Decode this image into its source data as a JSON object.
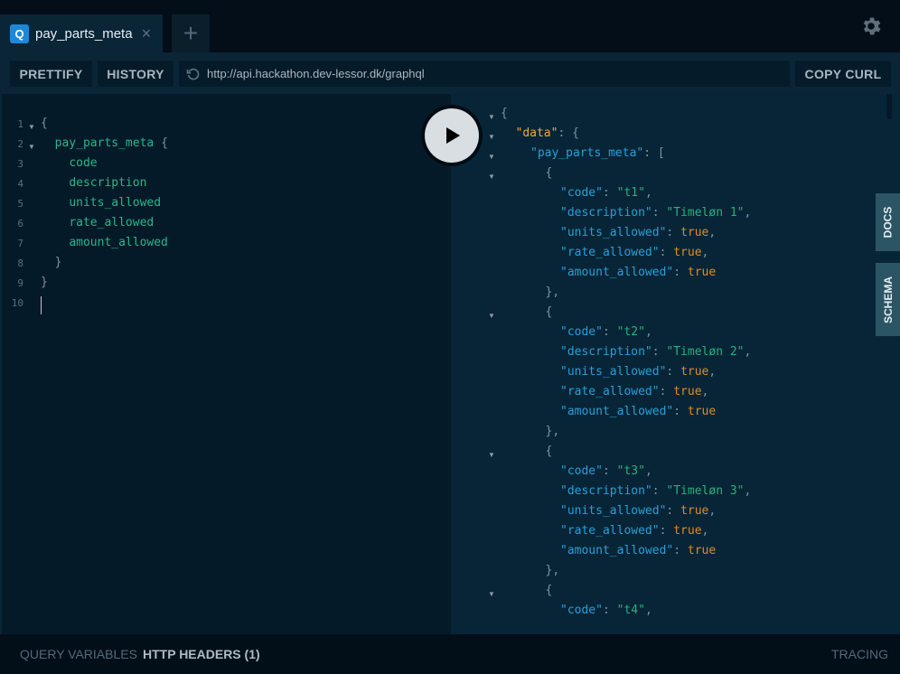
{
  "tabs": [
    {
      "badge": "Q",
      "label": "pay_parts_meta",
      "active": true
    }
  ],
  "icons": {
    "close": "close-icon",
    "new_tab": "plus-icon",
    "settings": "gear-icon",
    "history": "history-icon",
    "run": "play-icon"
  },
  "toolbar": {
    "prettify_label": "PRETTIFY",
    "history_label": "HISTORY",
    "endpoint_url": "http://api.hackathon.dev-lessor.dk/graphql",
    "copy_curl_label": "COPY CURL"
  },
  "query_editor": {
    "lines": [
      {
        "n": "1",
        "text": "{",
        "fold": true
      },
      {
        "n": "2",
        "text": "  pay_parts_meta {",
        "fold": true
      },
      {
        "n": "3",
        "text": "    code"
      },
      {
        "n": "4",
        "text": "    description"
      },
      {
        "n": "5",
        "text": "    units_allowed"
      },
      {
        "n": "6",
        "text": "    rate_allowed"
      },
      {
        "n": "7",
        "text": "    amount_allowed"
      },
      {
        "n": "8",
        "text": "  }"
      },
      {
        "n": "9",
        "text": "}"
      },
      {
        "n": "10",
        "text": ""
      }
    ]
  },
  "result": {
    "root_key": "data",
    "query_key": "pay_parts_meta",
    "items": [
      {
        "code": "t1",
        "description": "Timeløn 1",
        "units_allowed": "true",
        "rate_allowed": "true",
        "amount_allowed": "true"
      },
      {
        "code": "t2",
        "description": "Timeløn 2",
        "units_allowed": "true",
        "rate_allowed": "true",
        "amount_allowed": "true"
      },
      {
        "code": "t3",
        "description": "Timeløn 3",
        "units_allowed": "true",
        "rate_allowed": "true",
        "amount_allowed": "true"
      },
      {
        "code": "t4"
      }
    ]
  },
  "side_tabs": {
    "docs_label": "DOCS",
    "schema_label": "SCHEMA"
  },
  "bottom_bar": {
    "query_variables_label": "QUERY VARIABLES",
    "http_headers_label": "HTTP HEADERS (1)",
    "tracing_label": "TRACING"
  }
}
